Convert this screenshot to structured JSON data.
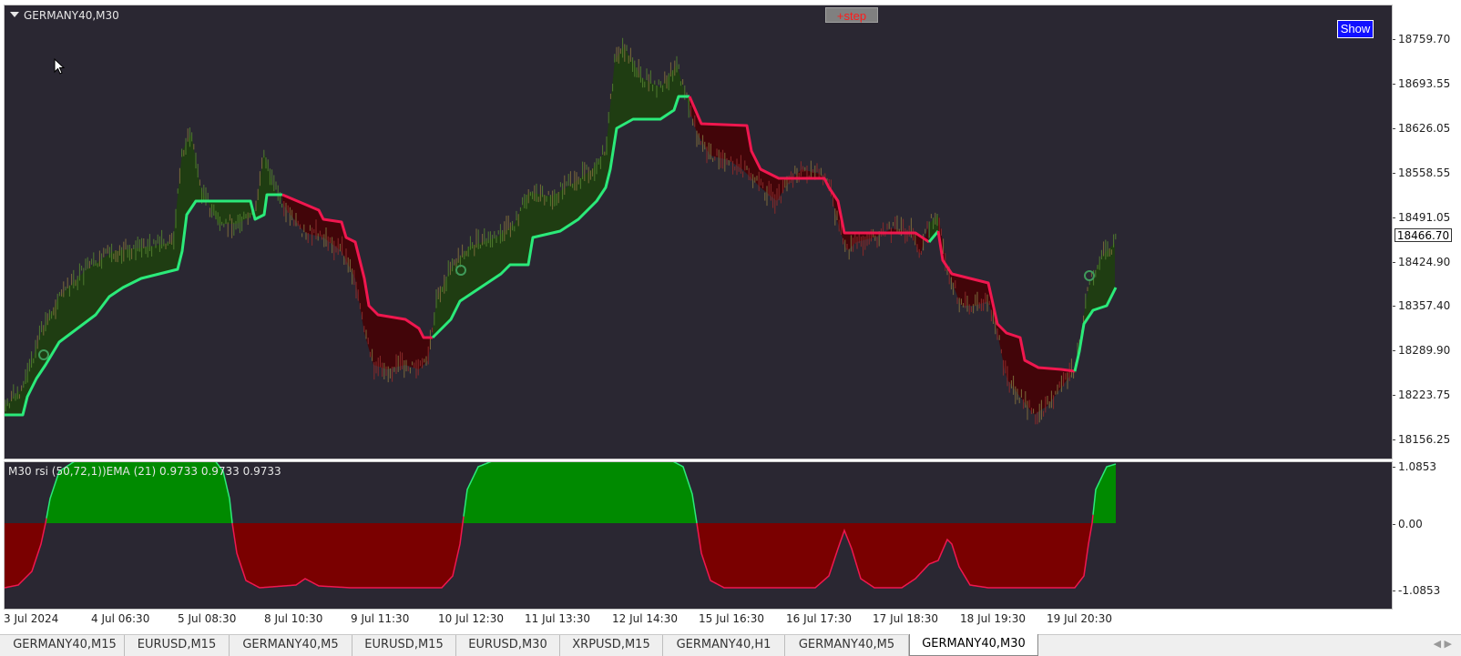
{
  "chart": {
    "symbol_title": "GERMANY40,M30",
    "step_button": "+step",
    "show_button": "Show",
    "price_ticks": [
      "18759.70",
      "18693.55",
      "18626.05",
      "18558.55",
      "18491.05",
      "18424.90",
      "18357.40",
      "18289.90",
      "18223.75",
      "18156.25"
    ],
    "current_price": "18466.70",
    "time_labels": [
      "3 Jul 2024",
      "4 Jul 06:30",
      "5 Jul 08:30",
      "8 Jul 10:30",
      "9 Jul 11:30",
      "10 Jul 12:30",
      "11 Jul 13:30",
      "12 Jul 14:30",
      "15 Jul 16:30",
      "16 Jul 17:30",
      "17 Jul 18:30",
      "18 Jul 19:30",
      "19 Jul 20:30"
    ],
    "colors": {
      "background": "#2a2732",
      "bull_line": "#2bea7a",
      "bear_line": "#f0174f",
      "bull_fill": "#1f3d12",
      "bear_fill": "#420509",
      "osc_green": "#008a00",
      "osc_red": "#7a0000"
    }
  },
  "indicator": {
    "title": "M30 rsi (50,72,1))EMA (21) 0.9733 0.9733 0.9733",
    "ticks": [
      "1.0853",
      "0.00",
      "-1.0853"
    ]
  },
  "tabs": [
    {
      "label": "GERMANY40,M15",
      "active": false
    },
    {
      "label": "EURUSD,M15",
      "active": false
    },
    {
      "label": "GERMANY40,M5",
      "active": false
    },
    {
      "label": "EURUSD,M15",
      "active": false
    },
    {
      "label": "EURUSD,M30",
      "active": false
    },
    {
      "label": "XRPUSD,M15",
      "active": false
    },
    {
      "label": "GERMANY40,H1",
      "active": false
    },
    {
      "label": "GERMANY40,M5",
      "active": false
    },
    {
      "label": "GERMANY40,M30",
      "active": true
    }
  ],
  "tab_scroll": "◀ ▶"
}
